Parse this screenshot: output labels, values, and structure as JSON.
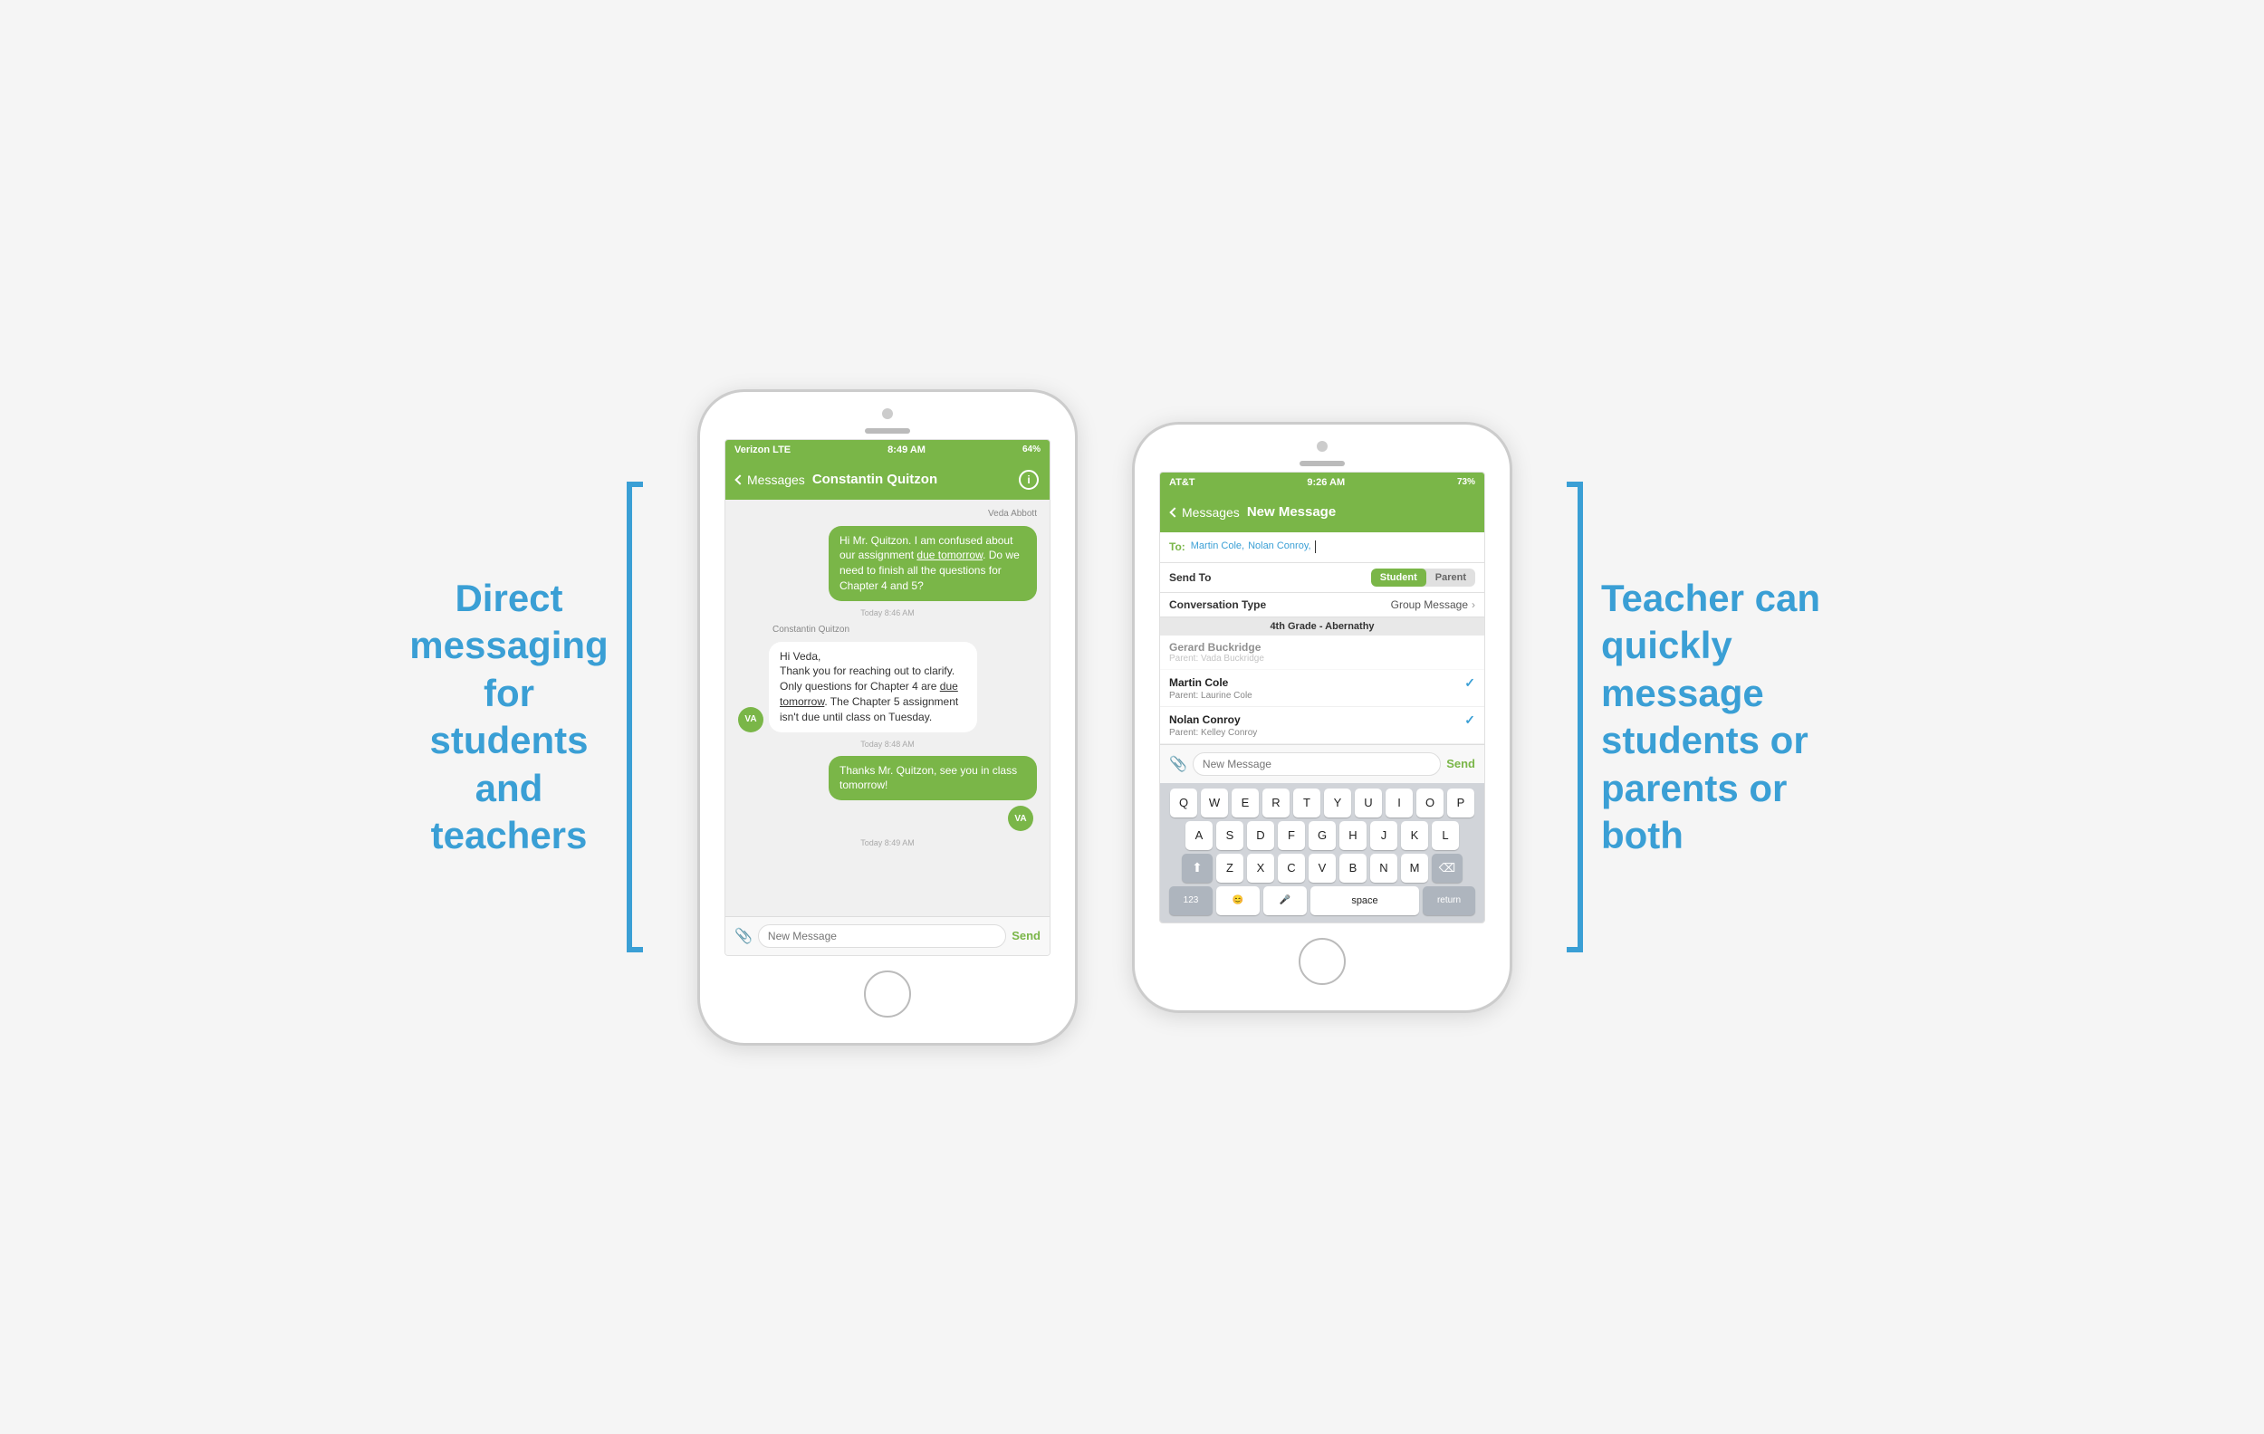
{
  "left_annotation": {
    "line1": "Direct",
    "line2": "messaging",
    "line3": "for",
    "line4": "students",
    "line5": "and",
    "line6": "teachers"
  },
  "right_annotation": {
    "line1": "Teacher can",
    "line2": "quickly",
    "line3": "message",
    "line4": "students or",
    "line5": "parents or",
    "line6": "both"
  },
  "phone1": {
    "status_bar": {
      "carrier": "Verizon  LTE",
      "time": "8:49 AM",
      "battery": "64%"
    },
    "nav": {
      "back": "Messages",
      "title": "Constantin Quitzon"
    },
    "messages": [
      {
        "type": "received",
        "sender": "Veda Abbott",
        "avatar": "VA",
        "text": "Hi Mr. Quitzon. I am confused about our assignment due tomorrow. Do we need to finish all the questions for Chapter 4 and 5?",
        "timestamp": "Today 8:46 AM",
        "has_underline": "due tomorrow"
      },
      {
        "type": "sent",
        "sender": "Constantin Quitzon",
        "text": "Hi Veda,\nThank you for reaching out to clarify. Only questions for Chapter 4 are due tomorrow. The Chapter 5 assignment isn't due until class on Tuesday.",
        "timestamp": "Today 8:48 AM",
        "has_underline": "due tomorrow"
      },
      {
        "type": "received",
        "sender": "",
        "avatar": "VA",
        "text": "Thanks Mr. Quitzon, see you in class tomorrow!",
        "timestamp": "Today 8:49 AM"
      }
    ],
    "message_input": {
      "placeholder": "New Message",
      "send": "Send"
    }
  },
  "phone2": {
    "status_bar": {
      "carrier": "AT&T",
      "time": "9:26 AM",
      "battery": "73%"
    },
    "nav": {
      "back": "Messages",
      "title": "New Message"
    },
    "to_field": {
      "label": "To:",
      "recipients": [
        "Martin Cole,",
        "Nolan Conroy,"
      ]
    },
    "send_to": {
      "label": "Send To",
      "options": [
        "Student",
        "Parent"
      ],
      "active": "Student"
    },
    "conversation_type": {
      "label": "Conversation Type",
      "value": "Group Message"
    },
    "section_header": "4th Grade - Abernathy",
    "contacts": [
      {
        "name": "Gerard Buckridge",
        "parent": "Parent: Vada Buckridge",
        "checked": false,
        "greyed": true
      },
      {
        "name": "Martin Cole",
        "parent": "Parent: Laurine Cole",
        "checked": true
      },
      {
        "name": "Nolan Conroy",
        "parent": "Parent: Kelley Conroy",
        "checked": true
      }
    ],
    "message_input": {
      "placeholder": "New Message",
      "send": "Send"
    },
    "keyboard": {
      "rows": [
        [
          "Q",
          "W",
          "E",
          "R",
          "T",
          "Y",
          "U",
          "I",
          "O",
          "P"
        ],
        [
          "A",
          "S",
          "D",
          "F",
          "G",
          "H",
          "J",
          "K",
          "L"
        ],
        [
          "↑",
          "Z",
          "X",
          "C",
          "V",
          "B",
          "N",
          "M",
          "⌫"
        ],
        [
          "123",
          "😊",
          "🎤",
          "space",
          "return"
        ]
      ]
    }
  }
}
